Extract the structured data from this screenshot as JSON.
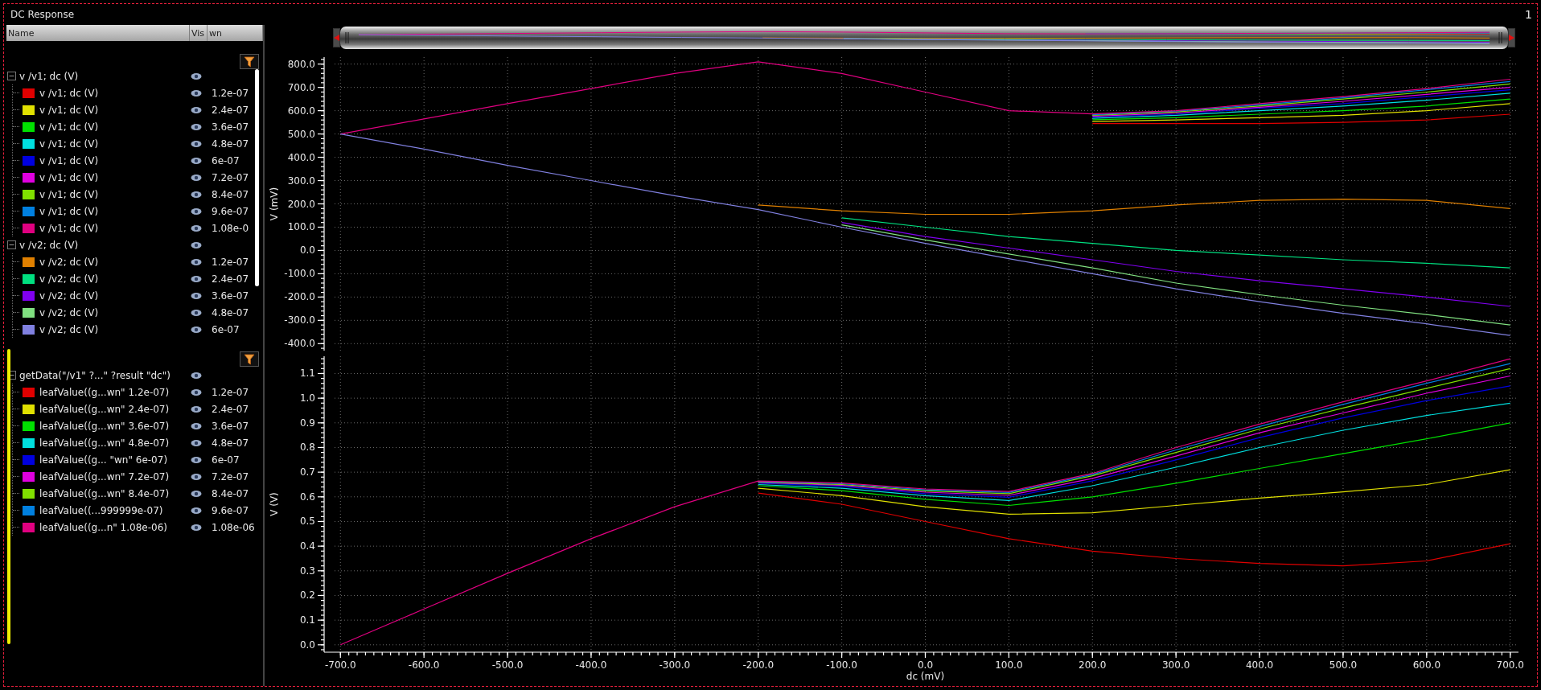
{
  "window": {
    "title": "DC Response",
    "corner_label": "1"
  },
  "columns": [
    "Name",
    "Vis",
    "wn"
  ],
  "trees": [
    {
      "groups": [
        {
          "label": "v /v1; dc (V)",
          "expanded": true,
          "children": [
            {
              "label": "v /v1; dc (V)",
              "wn": "1.2e-07",
              "color": "#e00000"
            },
            {
              "label": "v /v1; dc (V)",
              "wn": "2.4e-07",
              "color": "#e0e000"
            },
            {
              "label": "v /v1; dc (V)",
              "wn": "3.6e-07",
              "color": "#00e000"
            },
            {
              "label": "v /v1; dc (V)",
              "wn": "4.8e-07",
              "color": "#00e0e0"
            },
            {
              "label": "v /v1; dc (V)",
              "wn": "6e-07",
              "color": "#0000e0"
            },
            {
              "label": "v /v1; dc (V)",
              "wn": "7.2e-07",
              "color": "#e000e0"
            },
            {
              "label": "v /v1; dc (V)",
              "wn": "8.4e-07",
              "color": "#80e000"
            },
            {
              "label": "v /v1; dc (V)",
              "wn": "9.6e-07",
              "color": "#0080e0"
            },
            {
              "label": "v /v1; dc (V)",
              "wn": "1.08e-0",
              "color": "#e00080"
            }
          ]
        },
        {
          "label": "v /v2; dc (V)",
          "expanded": true,
          "children": [
            {
              "label": "v /v2; dc (V)",
              "wn": "1.2e-07",
              "color": "#e08000"
            },
            {
              "label": "v /v2; dc (V)",
              "wn": "2.4e-07",
              "color": "#00e080"
            },
            {
              "label": "v /v2; dc (V)",
              "wn": "3.6e-07",
              "color": "#8000f0"
            },
            {
              "label": "v /v2; dc (V)",
              "wn": "4.8e-07",
              "color": "#80e080"
            },
            {
              "label": "v /v2; dc (V)",
              "wn": "6e-07",
              "color": "#8080e0"
            }
          ]
        }
      ]
    },
    {
      "groups": [
        {
          "label": "getData(\"/v1\" ?...\" ?result \"dc\")",
          "expanded": true,
          "children": [
            {
              "label": "leafValue((g...wn\" 1.2e-07)",
              "wn": "1.2e-07",
              "color": "#e00000"
            },
            {
              "label": "leafValue((g...wn\" 2.4e-07)",
              "wn": "2.4e-07",
              "color": "#e0e000"
            },
            {
              "label": "leafValue((g...wn\" 3.6e-07)",
              "wn": "3.6e-07",
              "color": "#00e000"
            },
            {
              "label": "leafValue((g...wn\" 4.8e-07)",
              "wn": "4.8e-07",
              "color": "#00e0e0"
            },
            {
              "label": "leafValue((g... \"wn\" 6e-07)",
              "wn": "6e-07",
              "color": "#0000e0"
            },
            {
              "label": "leafValue((g...wn\" 7.2e-07)",
              "wn": "7.2e-07",
              "color": "#e000e0"
            },
            {
              "label": "leafValue((g...wn\" 8.4e-07)",
              "wn": "8.4e-07",
              "color": "#80e000"
            },
            {
              "label": "leafValue((...999999e-07)",
              "wn": "9.6e-07",
              "color": "#0080e0"
            },
            {
              "label": "leafValue((g...n\" 1.08e-06)",
              "wn": "1.08e-06",
              "color": "#e00080"
            }
          ]
        }
      ]
    }
  ],
  "plots": [
    {
      "chart_data": {
        "type": "line",
        "ylabel": "V (mV)",
        "grid": true,
        "x": [
          -700,
          -600,
          -500,
          -400,
          -300,
          -200,
          -100,
          0,
          100,
          200,
          300,
          400,
          500,
          600,
          700
        ],
        "xlim": [
          -707,
          707
        ],
        "ylim": [
          -430,
          830
        ],
        "yticks": [
          {
            "value": -400,
            "label": "-400.0"
          },
          {
            "value": -300,
            "label": "-300.0"
          },
          {
            "value": -200,
            "label": "-200.0"
          },
          {
            "value": -100,
            "label": "-100.0"
          },
          {
            "value": 0,
            "label": "0.0"
          },
          {
            "value": 100,
            "label": "100.0"
          },
          {
            "value": 200,
            "label": "200.0"
          },
          {
            "value": 300,
            "label": "300.0"
          },
          {
            "value": 400,
            "label": "400.0"
          },
          {
            "value": 500,
            "label": "500.0"
          },
          {
            "value": 600,
            "label": "600.0"
          },
          {
            "value": 700,
            "label": "700.0"
          },
          {
            "value": 800,
            "label": "800.0"
          }
        ],
        "series": [
          {
            "color": "#e00000",
            "values": [
              null,
              null,
              null,
              null,
              null,
              null,
              null,
              null,
              null,
              545,
              545,
              545,
              550,
              560,
              585
            ]
          },
          {
            "color": "#e0e000",
            "values": [
              null,
              null,
              null,
              null,
              null,
              null,
              null,
              null,
              null,
              553,
              560,
              570,
              580,
              600,
              630
            ]
          },
          {
            "color": "#00e000",
            "values": [
              null,
              null,
              null,
              null,
              null,
              null,
              null,
              null,
              null,
              561,
              570,
              585,
              600,
              620,
              650
            ]
          },
          {
            "color": "#00e0e0",
            "values": [
              null,
              null,
              null,
              null,
              null,
              null,
              null,
              null,
              null,
              567,
              580,
              600,
              620,
              645,
              675
            ]
          },
          {
            "color": "#0000e0",
            "values": [
              null,
              null,
              null,
              null,
              null,
              null,
              null,
              null,
              null,
              572,
              585,
              610,
              630,
              660,
              690
            ]
          },
          {
            "color": "#e000e0",
            "values": [
              null,
              null,
              null,
              null,
              null,
              null,
              null,
              null,
              null,
              576,
              590,
              615,
              640,
              670,
              700
            ]
          },
          {
            "color": "#80e000",
            "values": [
              null,
              null,
              null,
              null,
              null,
              null,
              null,
              null,
              null,
              580,
              595,
              620,
              650,
              680,
              715
            ]
          },
          {
            "color": "#0080e0",
            "values": [
              null,
              null,
              null,
              null,
              null,
              null,
              null,
              null,
              null,
              583,
              598,
              625,
              655,
              690,
              725
            ]
          },
          {
            "color": "#e00080",
            "values": [
              500,
              565,
              630,
              695,
              760,
              810,
              760,
              680,
              600,
              586,
              600,
              630,
              660,
              695,
              735
            ]
          },
          {
            "color": "#e08000",
            "values": [
              null,
              null,
              null,
              null,
              null,
              195,
              170,
              155,
              155,
              170,
              195,
              215,
              220,
              215,
              180
            ]
          },
          {
            "color": "#00e080",
            "values": [
              null,
              null,
              null,
              null,
              null,
              null,
              140,
              100,
              60,
              30,
              0,
              -20,
              -40,
              -55,
              -75
            ]
          },
          {
            "color": "#8000f0",
            "values": [
              null,
              null,
              null,
              null,
              null,
              null,
              120,
              60,
              10,
              -40,
              -90,
              -130,
              -165,
              -200,
              -240
            ]
          },
          {
            "color": "#80e080",
            "values": [
              null,
              null,
              null,
              null,
              null,
              null,
              110,
              45,
              -15,
              -75,
              -140,
              -190,
              -235,
              -275,
              -320
            ]
          },
          {
            "color": "#8080e0",
            "values": [
              500,
              435,
              365,
              300,
              235,
              175,
              100,
              30,
              -35,
              -100,
              -165,
              -220,
              -270,
              -315,
              -365
            ]
          }
        ]
      }
    },
    {
      "chart_data": {
        "type": "line",
        "xlabel": "dc (mV)",
        "ylabel": "V (V)",
        "grid": true,
        "x": [
          -700,
          -600,
          -500,
          -400,
          -300,
          -200,
          -100,
          0,
          100,
          200,
          300,
          400,
          500,
          600,
          700
        ],
        "xlim": [
          -707,
          707
        ],
        "ylim": [
          -0.03,
          1.17
        ],
        "xticks": [
          {
            "value": -700,
            "label": "-700.0"
          },
          {
            "value": -600,
            "label": "-600.0"
          },
          {
            "value": -500,
            "label": "-500.0"
          },
          {
            "value": -400,
            "label": "-400.0"
          },
          {
            "value": -300,
            "label": "-300.0"
          },
          {
            "value": -200,
            "label": "-200.0"
          },
          {
            "value": -100,
            "label": "-100.0"
          },
          {
            "value": 0,
            "label": "0.0"
          },
          {
            "value": 100,
            "label": "100.0"
          },
          {
            "value": 200,
            "label": "200.0"
          },
          {
            "value": 300,
            "label": "300.0"
          },
          {
            "value": 400,
            "label": "400.0"
          },
          {
            "value": 500,
            "label": "500.0"
          },
          {
            "value": 600,
            "label": "600.0"
          },
          {
            "value": 700,
            "label": "700.0"
          }
        ],
        "yticks": [
          {
            "value": 0,
            "label": "0.0"
          },
          {
            "value": 0.1,
            "label": "0.1"
          },
          {
            "value": 0.2,
            "label": "0.2"
          },
          {
            "value": 0.3,
            "label": "0.3"
          },
          {
            "value": 0.4,
            "label": "0.4"
          },
          {
            "value": 0.5,
            "label": "0.5"
          },
          {
            "value": 0.6,
            "label": "0.6"
          },
          {
            "value": 0.7,
            "label": "0.7"
          },
          {
            "value": 0.8,
            "label": "0.8"
          },
          {
            "value": 0.9,
            "label": "0.9"
          },
          {
            "value": 1.0,
            "label": "1.0"
          },
          {
            "value": 1.1,
            "label": "1.1"
          }
        ],
        "series": [
          {
            "color": "#e00000",
            "values": [
              null,
              null,
              null,
              null,
              null,
              0.615,
              0.57,
              0.5,
              0.43,
              0.38,
              0.35,
              0.33,
              0.32,
              0.34,
              0.41
            ]
          },
          {
            "color": "#e0e000",
            "values": [
              null,
              null,
              null,
              null,
              null,
              0.635,
              0.605,
              0.56,
              0.53,
              0.535,
              0.565,
              0.595,
              0.62,
              0.65,
              0.71
            ]
          },
          {
            "color": "#00e000",
            "values": [
              null,
              null,
              null,
              null,
              null,
              0.645,
              0.625,
              0.59,
              0.565,
              0.6,
              0.655,
              0.715,
              0.775,
              0.835,
              0.9
            ]
          },
          {
            "color": "#00e0e0",
            "values": [
              null,
              null,
              null,
              null,
              null,
              0.65,
              0.635,
              0.605,
              0.585,
              0.645,
              0.72,
              0.8,
              0.87,
              0.93,
              0.98
            ]
          },
          {
            "color": "#0000e0",
            "values": [
              null,
              null,
              null,
              null,
              null,
              0.655,
              0.642,
              0.613,
              0.598,
              0.665,
              0.75,
              0.84,
              0.92,
              0.99,
              1.05
            ]
          },
          {
            "color": "#e000e0",
            "values": [
              null,
              null,
              null,
              null,
              null,
              0.658,
              0.647,
              0.619,
              0.606,
              0.675,
              0.765,
              0.86,
              0.94,
              1.02,
              1.09
            ]
          },
          {
            "color": "#80e000",
            "values": [
              null,
              null,
              null,
              null,
              null,
              0.66,
              0.65,
              0.624,
              0.613,
              0.685,
              0.78,
              0.875,
              0.96,
              1.04,
              1.12
            ]
          },
          {
            "color": "#0080e0",
            "values": [
              null,
              null,
              null,
              null,
              null,
              0.662,
              0.653,
              0.628,
              0.618,
              0.69,
              0.79,
              0.885,
              0.975,
              1.06,
              1.14
            ]
          },
          {
            "color": "#e00080",
            "values": [
              0,
              0.145,
              0.29,
              0.43,
              0.56,
              0.664,
              0.656,
              0.632,
              0.622,
              0.695,
              0.8,
              0.895,
              0.985,
              1.07,
              1.16
            ]
          }
        ]
      }
    }
  ]
}
